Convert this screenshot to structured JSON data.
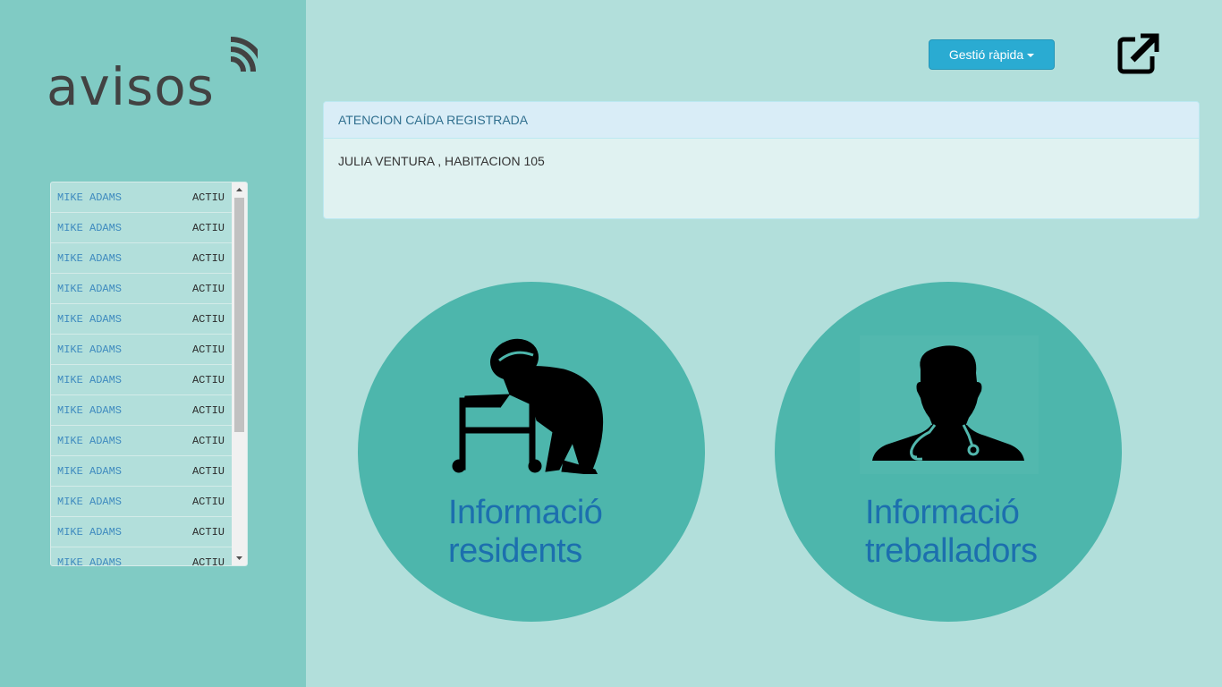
{
  "logo": {
    "text": "avisos",
    "icon": "wifi-signal-icon",
    "color": "#424242"
  },
  "header": {
    "quick_menu_label": "Gestió ràpida",
    "external_link_icon": "external-link-icon"
  },
  "alert": {
    "title": "ATENCION CAÍDA REGISTRADA",
    "message": "JULIA VENTURA , HABITACION 105"
  },
  "worker_list": {
    "rows": [
      {
        "name": "MIKE ADAMS",
        "status": "ACTIU"
      },
      {
        "name": "MIKE ADAMS",
        "status": "ACTIU"
      },
      {
        "name": "MIKE ADAMS",
        "status": "ACTIU"
      },
      {
        "name": "MIKE ADAMS",
        "status": "ACTIU"
      },
      {
        "name": "MIKE ADAMS",
        "status": "ACTIU"
      },
      {
        "name": "MIKE ADAMS",
        "status": "ACTIU"
      },
      {
        "name": "MIKE ADAMS",
        "status": "ACTIU"
      },
      {
        "name": "MIKE ADAMS",
        "status": "ACTIU"
      },
      {
        "name": "MIKE ADAMS",
        "status": "ACTIU"
      },
      {
        "name": "MIKE ADAMS",
        "status": "ACTIU"
      },
      {
        "name": "MIKE ADAMS",
        "status": "ACTIU"
      },
      {
        "name": "MIKE ADAMS",
        "status": "ACTIU"
      },
      {
        "name": "MIKE ADAMS",
        "status": "ACTIU"
      }
    ]
  },
  "cards": {
    "residents": {
      "line1": "Informació",
      "line2": "residents",
      "icon": "elderly-walker-icon"
    },
    "workers": {
      "line1": "Informació",
      "line2": "treballadors",
      "icon": "doctor-icon"
    }
  },
  "colors": {
    "main_bg": "#b2dfdb",
    "sidebar_bg": "#80cbc4",
    "circle": "#4db6ac",
    "accent_button": "#2aabd2",
    "card_text": "#1c6fae"
  }
}
